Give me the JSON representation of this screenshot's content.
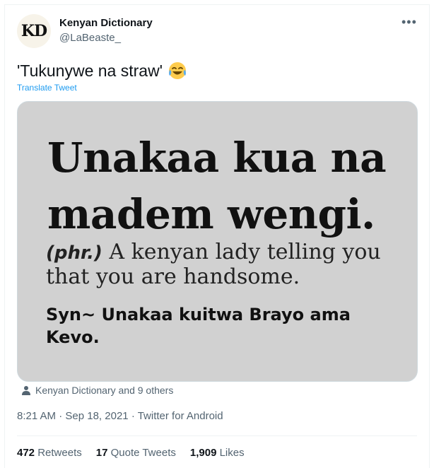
{
  "author": {
    "avatar_text": "KD",
    "name": "Kenyan Dictionary",
    "handle": "@LaBeaste_"
  },
  "tweet": {
    "text": "'Tukunywe na straw'",
    "emoji_icon": "face-with-tears-of-joy",
    "translate_label": "Translate Tweet"
  },
  "image": {
    "line1": "Unakaa kua na",
    "line2": "madem wengi.",
    "phr": "(phr.)",
    "definition": " A kenyan lady telling you that you are handsome.",
    "syn": "Syn~ Unakaa kuitwa Brayo ama Kevo."
  },
  "tagged": "Kenyan Dictionary and 9 others",
  "meta": {
    "time": "8:21 AM",
    "date": "Sep 18, 2021",
    "source": "Twitter for Android"
  },
  "stats": {
    "retweets_count": "472",
    "retweets_label": "Retweets",
    "quotes_count": "17",
    "quotes_label": "Quote Tweets",
    "likes_count": "1,909",
    "likes_label": "Likes"
  }
}
